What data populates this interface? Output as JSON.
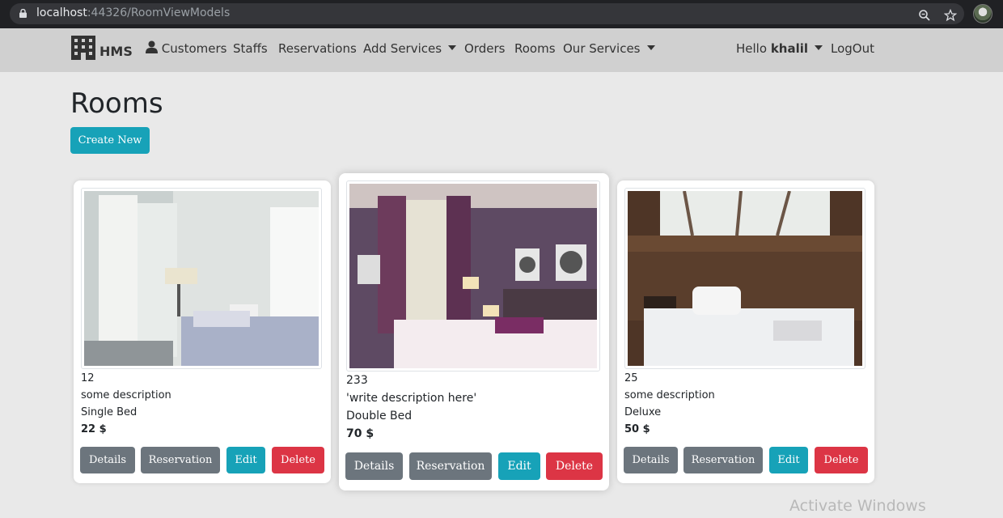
{
  "browser": {
    "url_host": "localhost",
    "url_path": ":44326/RoomViewModels"
  },
  "navbar": {
    "brand": "HMS",
    "items": [
      {
        "label": "Customers"
      },
      {
        "label": "Staffs"
      },
      {
        "label": "Reservations"
      },
      {
        "label": "Add Services"
      },
      {
        "label": "Orders"
      },
      {
        "label": "Rooms"
      },
      {
        "label": "Our Services"
      }
    ],
    "greeting": "Hello",
    "user": "khalil",
    "logout": "LogOut"
  },
  "page": {
    "title": "Rooms",
    "create_label": "Create New"
  },
  "rooms": [
    {
      "number": "12",
      "description": "some description",
      "type": "Single Bed",
      "price": "22 $"
    },
    {
      "number": "233",
      "description": "'write description here'",
      "type": "Double Bed",
      "price": "70 $"
    },
    {
      "number": "25",
      "description": "some description",
      "type": "Deluxe",
      "price": "50 $"
    }
  ],
  "actions": {
    "details": "Details",
    "reservation": "Reservation",
    "edit": "Edit",
    "delete": "Delete"
  },
  "watermark": "Activate Windows",
  "colors": {
    "info": "#17a2b8",
    "secondary": "#6c757d",
    "danger": "#dc3545"
  }
}
